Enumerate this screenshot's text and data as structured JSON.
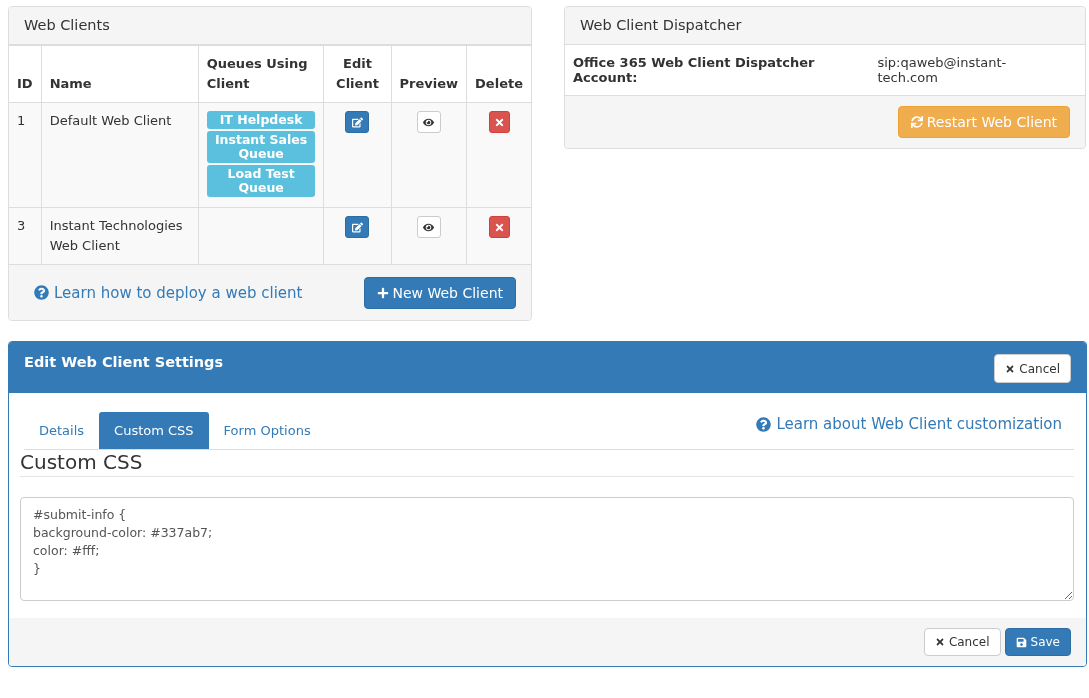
{
  "web_clients": {
    "title": "Web Clients",
    "columns": [
      "ID",
      "Name",
      "Queues Using Client",
      "Edit Client",
      "Preview",
      "Delete"
    ],
    "rows": [
      {
        "id": "1",
        "name": "Default Web Client",
        "queues": [
          "IT Helpdesk",
          "Instant Sales Queue",
          "Load Test Queue"
        ]
      },
      {
        "id": "3",
        "name": "Instant Technologies Web Client",
        "queues": []
      }
    ],
    "help_link": "Learn how to deploy a web client",
    "new_button": "New Web Client"
  },
  "dispatcher": {
    "title": "Web Client Dispatcher",
    "label": "Office 365 Web Client Dispatcher Account:",
    "value": "sip:qaweb@instant-tech.com",
    "restart_button": "Restart Web Client"
  },
  "settings": {
    "title": "Edit Web Client Settings",
    "header_cancel": "Cancel",
    "tabs": [
      {
        "label": "Details",
        "selected": false
      },
      {
        "label": "Custom CSS",
        "selected": true
      },
      {
        "label": "Form Options",
        "selected": false
      }
    ],
    "help_link": "Learn about Web Client customization",
    "section_title": "Custom CSS",
    "css_value": "#submit-info {\nbackground-color: #337ab7;\ncolor: #fff;\n}",
    "cancel_button": "Cancel",
    "save_button": "Save"
  }
}
